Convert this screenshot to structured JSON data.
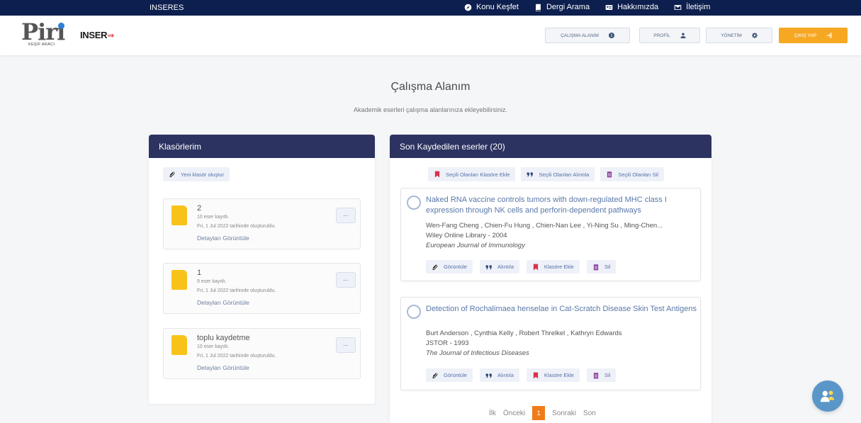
{
  "topbar": {
    "brand": "INSERES",
    "nav": [
      {
        "label": "Konu Keşfet",
        "icon": "compass-icon"
      },
      {
        "label": "Dergi Arama",
        "icon": "book-icon"
      },
      {
        "label": "Hakkımızda",
        "icon": "id-card-icon"
      },
      {
        "label": "İletişim",
        "icon": "envelope-icon"
      }
    ]
  },
  "header": {
    "logo_text": "Piri",
    "logo_sub": "KEŞİF ARACI",
    "brand": "INSER",
    "buttons": {
      "workspace": "ÇALIŞMA ALANIM",
      "profile": "PROFİL",
      "admin": "YÖNETİM",
      "logout": "ÇIKIŞ YAP"
    }
  },
  "page": {
    "title": "Çalışma Alanım",
    "subtitle": "Akademik eserleri çalışma alanlarınıza ekleyebilirsiniz."
  },
  "folders_panel": {
    "title": "Klasörlerim",
    "new_folder": "Yeni klasör oluştur",
    "folders": [
      {
        "name": "2",
        "count": "10 eser kayıtlı.",
        "date": "Fri, 1 Jul 2022 tarihinde oluşturuldu.",
        "details": "Detayları Görüntüle",
        "more": "..."
      },
      {
        "name": "1",
        "count": "9 eser kayıtlı.",
        "date": "Fri, 1 Jul 2022 tarihinde oluşturuldu.",
        "details": "Detayları Görüntüle",
        "more": "..."
      },
      {
        "name": "toplu kaydetme",
        "count": "10 eser kayıtlı.",
        "date": "Fri, 1 Jul 2022 tarihinde oluşturuldu.",
        "details": "Detayları Görüntüle",
        "more": "..."
      }
    ]
  },
  "records_panel": {
    "title": "Son Kaydedilen eserler (20)",
    "bulk": {
      "add_folder": "Seçili Olanları Klasöre Ekle",
      "cite": "Seçili Olanları Alıntıla",
      "delete": "Seçili Olanları Sil"
    },
    "records": [
      {
        "title": "Naked RNA vaccine controls tumors with down-regulated MHC class I expression through NK cells and perforin-dependent pathways",
        "authors": "Wen-Fang Cheng , Chien-Fu Hung , Chien-Nan Lee , Yi-Ning Su , Ming-Chen...",
        "source": "Wiley Online Library - 2004",
        "journal": "European Journal of Immunology"
      },
      {
        "title": "Detection of Rochalimaea henselae in Cat-Scratch Disease Skin Test Antigens",
        "authors": "Burt Anderson , Cynthia Kelly , Robert Threlkel , Kathryn Edwards",
        "source": "JSTOR - 1993",
        "journal": "The Journal of Infectious Diseases"
      }
    ],
    "actions": {
      "view": "Görüntüle",
      "cite": "Alıntıla",
      "add_folder": "Klasöre Ekle",
      "delete": "Sil"
    }
  },
  "pager": {
    "first": "İlk",
    "prev": "Önceki",
    "current": "1",
    "next": "Sonraki",
    "last": "Son"
  },
  "colors": {
    "topbar": "#0d1f4e",
    "panel_head": "#2c3360",
    "accent": "#f7a823",
    "folder": "#f8c318",
    "bookmark": "#d9314b",
    "quote": "#243a6e",
    "trash": "#8a3a9a"
  }
}
